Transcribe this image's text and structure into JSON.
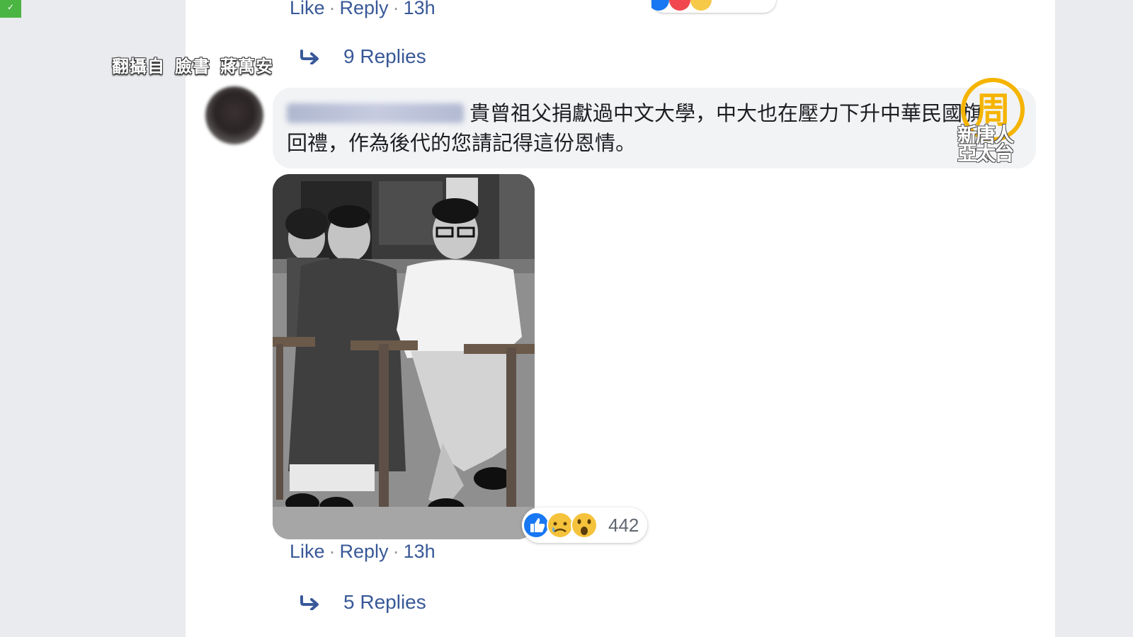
{
  "overlay": {
    "credit": [
      "翻攝自",
      "臉書",
      "蔣萬安"
    ],
    "logo_char": "周",
    "logo_lines": [
      "新唐人",
      "亞太台"
    ]
  },
  "top_actions": {
    "like": "Like",
    "sep": "·",
    "reply": "Reply",
    "time": "13h"
  },
  "top_replies": "9 Replies",
  "comment": {
    "text": "貴曾祖父捐獻過中文大學，中大也在壓力下升中華民國旗回禮，作為後代的您請記得這份恩情。"
  },
  "reactions": {
    "count": "442",
    "icons": [
      "like-icon",
      "sad-icon",
      "wow-icon"
    ]
  },
  "bottom_actions": {
    "like": "Like",
    "sep": "·",
    "reply": "Reply",
    "time": "13h"
  },
  "bottom_replies": "5 Replies",
  "colors": {
    "link": "#385898",
    "bubble": "#f2f3f5",
    "page_bg": "#e9ebee",
    "logo_gold": "#f5b400"
  }
}
